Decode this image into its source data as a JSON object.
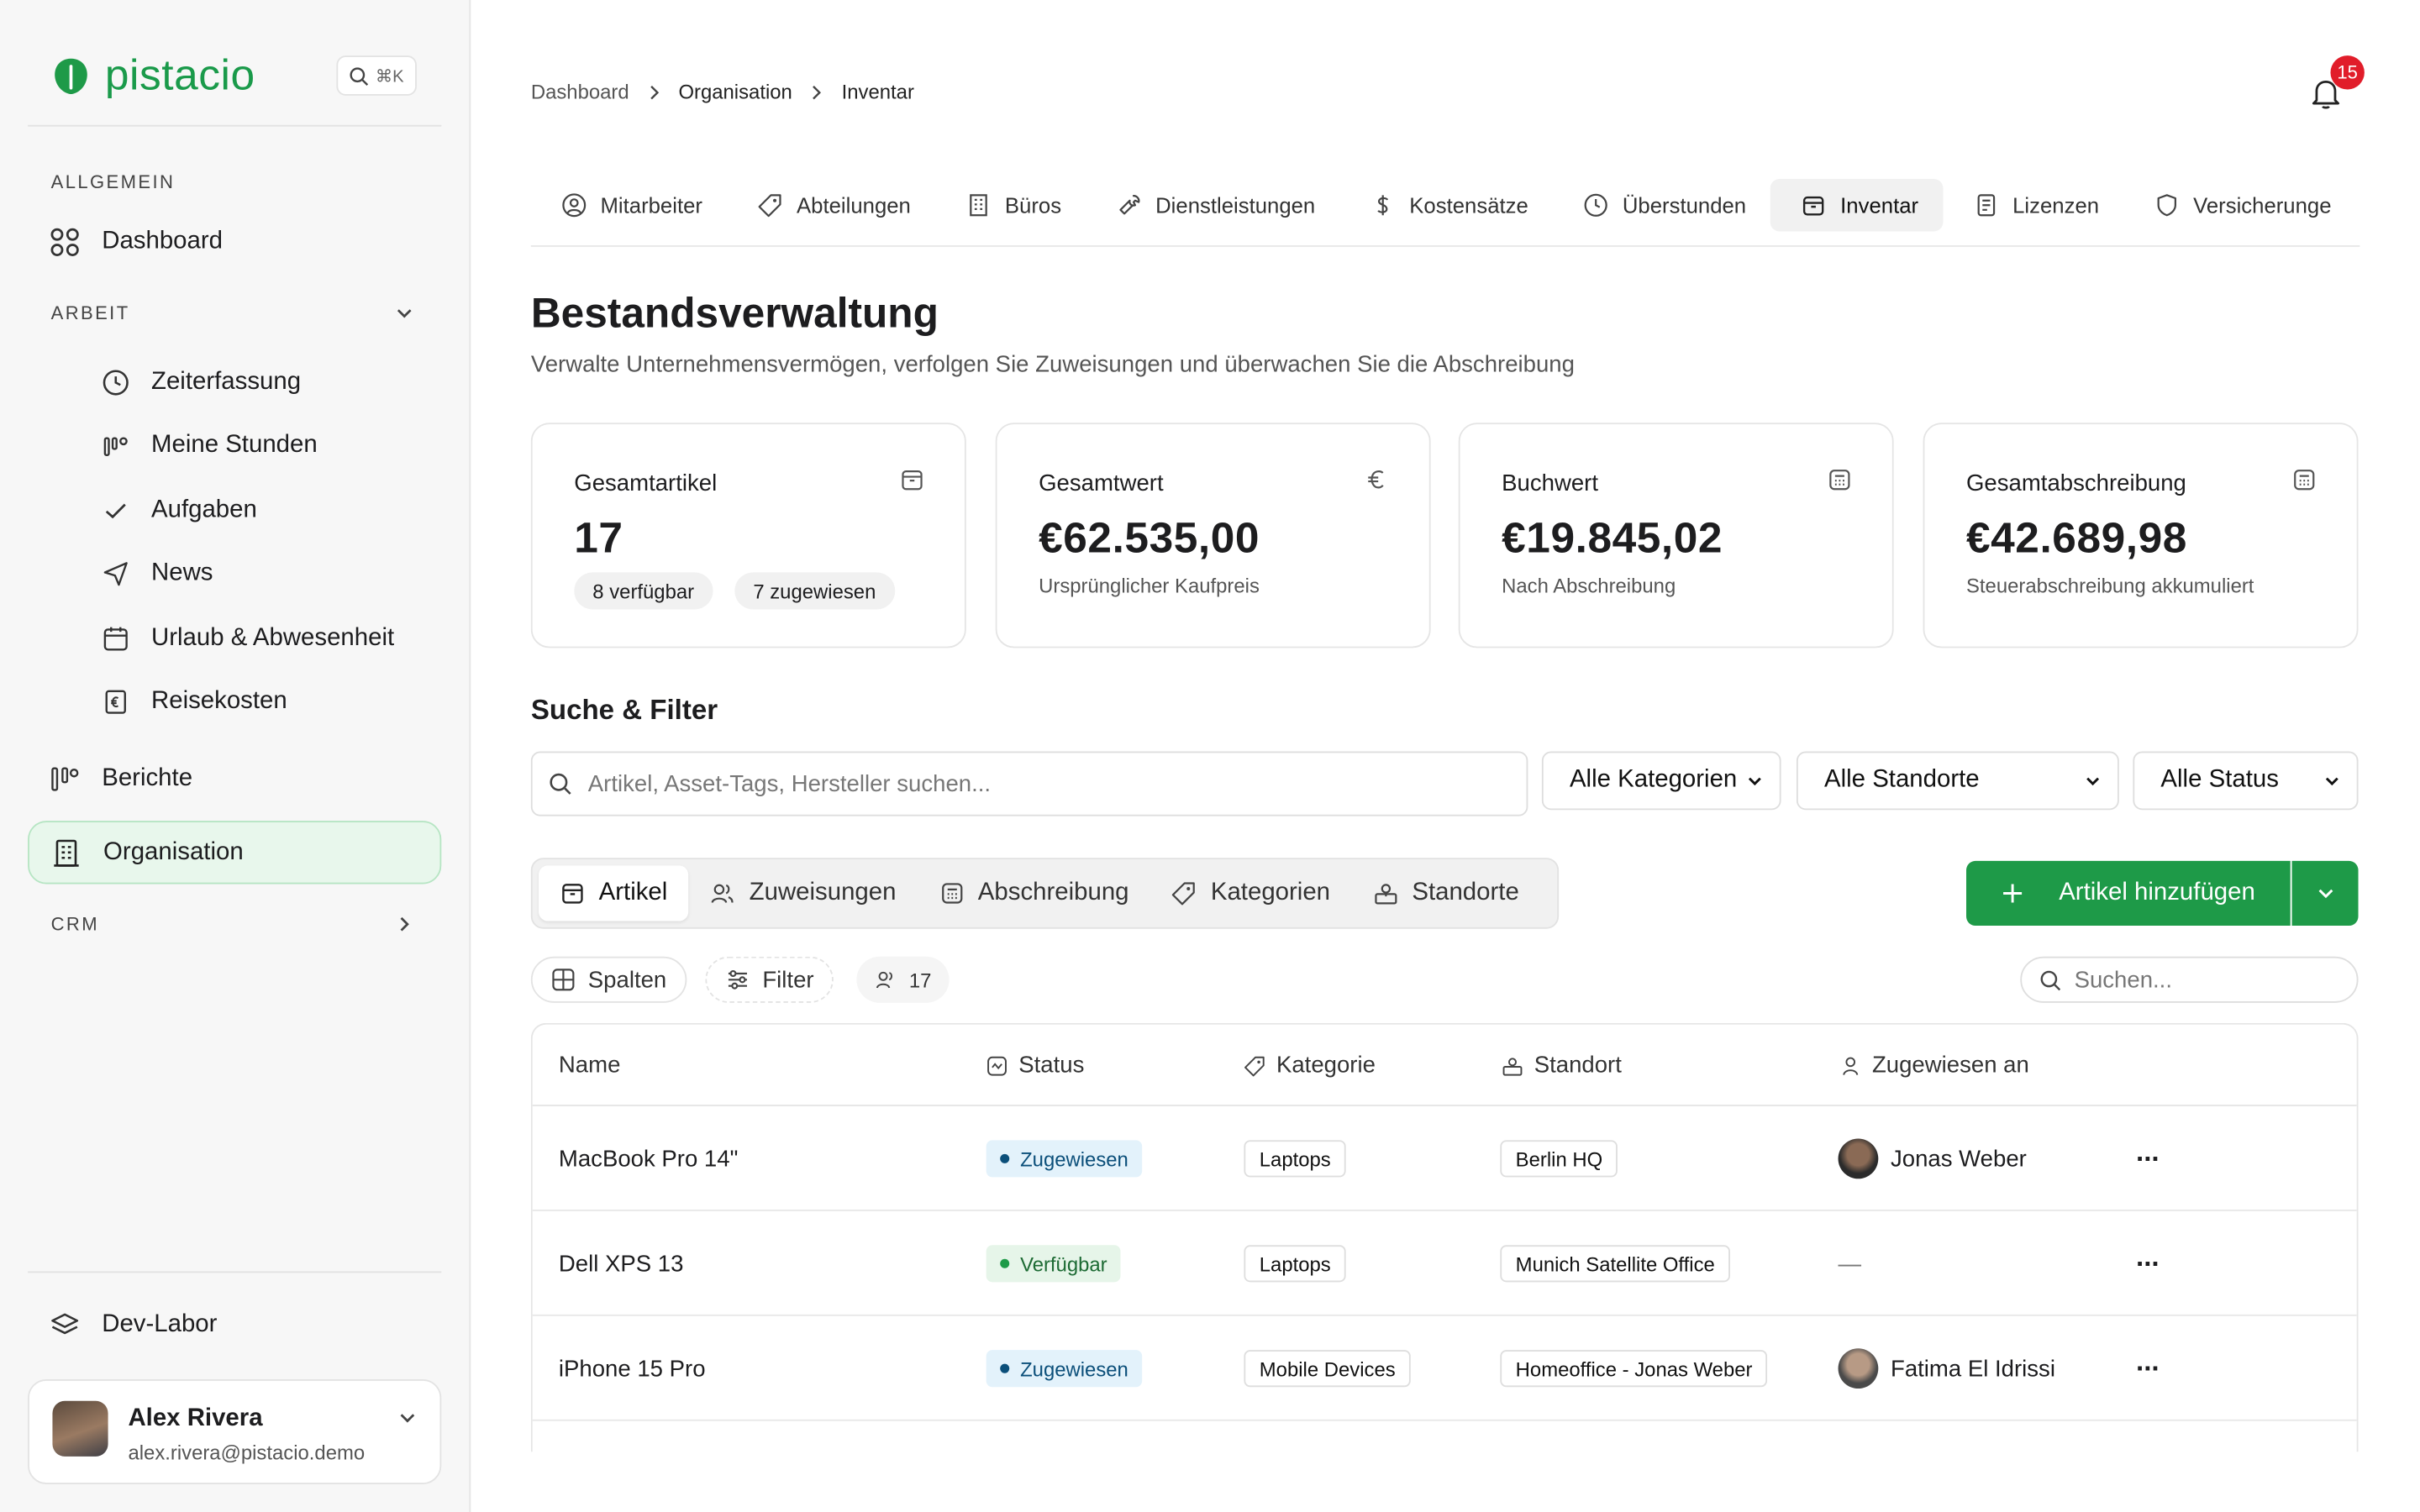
{
  "app": {
    "name": "pistacio",
    "shortcut": "⌘K"
  },
  "sidebar": {
    "section_general": "ALLGEMEIN",
    "dashboard": "Dashboard",
    "section_work": "ARBEIT",
    "work_items": [
      {
        "label": "Zeiterfassung",
        "icon": "clock-icon"
      },
      {
        "label": "Meine Stunden",
        "icon": "hours-icon"
      },
      {
        "label": "Aufgaben",
        "icon": "check-icon"
      },
      {
        "label": "News",
        "icon": "send-icon"
      },
      {
        "label": "Urlaub & Abwesenheit",
        "icon": "calendar-icon"
      },
      {
        "label": "Reisekosten",
        "icon": "receipt-icon"
      }
    ],
    "reports": "Berichte",
    "organisation": "Organisation",
    "section_crm": "CRM",
    "devlab": "Dev-Labor",
    "user": {
      "name": "Alex Rivera",
      "email": "alex.rivera@pistacio.demo"
    }
  },
  "header": {
    "breadcrumb": [
      "Dashboard",
      "Organisation",
      "Inventar"
    ],
    "notification_count": "15"
  },
  "tabs": [
    {
      "label": "Mitarbeiter",
      "icon": "user-circle-icon"
    },
    {
      "label": "Abteilungen",
      "icon": "tag-icon"
    },
    {
      "label": "Büros",
      "icon": "building-icon"
    },
    {
      "label": "Dienstleistungen",
      "icon": "wrench-icon"
    },
    {
      "label": "Kostensätze",
      "icon": "dollar-icon"
    },
    {
      "label": "Überstunden",
      "icon": "clock-icon"
    },
    {
      "label": "Inventar",
      "icon": "box-icon",
      "active": true
    },
    {
      "label": "Lizenzen",
      "icon": "license-icon"
    },
    {
      "label": "Versicherunge",
      "icon": "shield-icon"
    }
  ],
  "page": {
    "title": "Bestandsverwaltung",
    "subtitle": "Verwalte Unternehmensvermögen, verfolgen Sie Zuweisungen und überwachen Sie die Abschreibung"
  },
  "stats": {
    "total_items": {
      "label": "Gesamtartikel",
      "value": "17",
      "available": "8 verfügbar",
      "assigned": "7 zugewiesen"
    },
    "total_value": {
      "label": "Gesamtwert",
      "value": "€62.535,00",
      "note": "Ursprünglicher Kaufpreis"
    },
    "book_value": {
      "label": "Buchwert",
      "value": "€19.845,02",
      "note": "Nach Abschreibung"
    },
    "depreciation": {
      "label": "Gesamtabschreibung",
      "value": "€42.689,98",
      "note": "Steuerabschreibung akkumuliert"
    }
  },
  "filters": {
    "title": "Suche & Filter",
    "search_placeholder": "Artikel, Asset-Tags, Hersteller suchen...",
    "category": "Alle Kategorien",
    "location": "Alle Standorte",
    "status": "Alle Status"
  },
  "subtabs": [
    "Artikel",
    "Zuweisungen",
    "Abschreibung",
    "Kategorien",
    "Standorte"
  ],
  "actions": {
    "add": "Artikel hinzufügen"
  },
  "toolbar": {
    "columns": "Spalten",
    "filter": "Filter",
    "count": "17",
    "search_placeholder": "Suchen..."
  },
  "table": {
    "headers": [
      "Name",
      "Status",
      "Kategorie",
      "Standort",
      "Zugewiesen an"
    ],
    "rows": [
      {
        "name": "MacBook Pro 14\"",
        "status": "Zugewiesen",
        "category": "Laptops",
        "location": "Berlin HQ",
        "assignee": "Jonas Weber"
      },
      {
        "name": "Dell XPS 13",
        "status": "Verfügbar",
        "category": "Laptops",
        "location": "Munich Satellite Office",
        "assignee": "—"
      },
      {
        "name": "iPhone 15 Pro",
        "status": "Zugewiesen",
        "category": "Mobile Devices",
        "location": "Homeoffice - Jonas Weber",
        "assignee": "Fatima El Idrissi"
      }
    ]
  },
  "colors": {
    "brand": "#1e9a48",
    "active_bg": "#e8f7ec",
    "badge": "#e11d2a"
  }
}
